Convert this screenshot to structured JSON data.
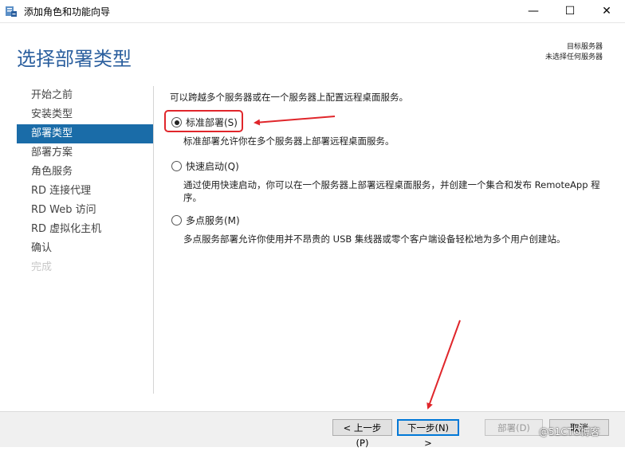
{
  "window": {
    "title": "添加角色和功能向导",
    "minimize_glyph": "—",
    "maximize_glyph": "☐",
    "close_glyph": "✕"
  },
  "header": {
    "title": "选择部署类型",
    "destination_label": "目标服务器",
    "destination_value": "未选择任何服务器"
  },
  "nav": {
    "items": [
      {
        "label": "开始之前",
        "state": "normal"
      },
      {
        "label": "安装类型",
        "state": "normal"
      },
      {
        "label": "部署类型",
        "state": "active"
      },
      {
        "label": "部署方案",
        "state": "normal"
      },
      {
        "label": "角色服务",
        "state": "normal"
      },
      {
        "label": "RD 连接代理",
        "state": "normal"
      },
      {
        "label": "RD Web 访问",
        "state": "normal"
      },
      {
        "label": "RD 虚拟化主机",
        "state": "normal"
      },
      {
        "label": "确认",
        "state": "normal"
      },
      {
        "label": "完成",
        "state": "disabled"
      }
    ]
  },
  "content": {
    "intro": "可以跨越多个服务器或在一个服务器上配置远程桌面服务。",
    "options": [
      {
        "label": "标准部署(S)",
        "selected": true,
        "description": "标准部署允许你在多个服务器上部署远程桌面服务。"
      },
      {
        "label": "快速启动(Q)",
        "selected": false,
        "description": "通过使用快速启动，你可以在一个服务器上部署远程桌面服务，并创建一个集合和发布 RemoteApp 程序。"
      },
      {
        "label": "多点服务(M)",
        "selected": false,
        "description": "多点服务部署允许你使用并不昂贵的 USB 集线器或零个客户端设备轻松地为多个用户创建站。"
      }
    ]
  },
  "footer": {
    "prev_label": "< 上一步(P)",
    "next_label": "下一步(N) >",
    "deploy_label": "部署(D)",
    "cancel_label": "取消"
  },
  "watermark": "@51CTO博客",
  "colors": {
    "header_title": "#2b5f9e",
    "nav_active_bg": "#1a6ca8",
    "annotation_red": "#e0262b",
    "focus_blue": "#0078d7"
  }
}
